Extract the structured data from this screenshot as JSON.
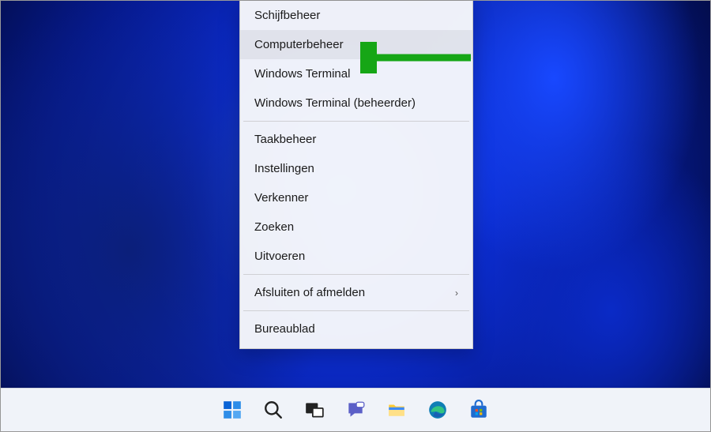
{
  "menu": {
    "items": [
      {
        "label": "Schijfbeheer",
        "hovered": false,
        "hasSubmenu": false
      },
      {
        "label": "Computerbeheer",
        "hovered": true,
        "hasSubmenu": false
      },
      {
        "label": "Windows Terminal",
        "hovered": false,
        "hasSubmenu": false
      },
      {
        "label": "Windows Terminal (beheerder)",
        "hovered": false,
        "hasSubmenu": false,
        "dividerAfter": true
      },
      {
        "label": "Taakbeheer",
        "hovered": false,
        "hasSubmenu": false
      },
      {
        "label": "Instellingen",
        "hovered": false,
        "hasSubmenu": false
      },
      {
        "label": "Verkenner",
        "hovered": false,
        "hasSubmenu": false
      },
      {
        "label": "Zoeken",
        "hovered": false,
        "hasSubmenu": false
      },
      {
        "label": "Uitvoeren",
        "hovered": false,
        "hasSubmenu": false,
        "dividerAfter": true
      },
      {
        "label": "Afsluiten of afmelden",
        "hovered": false,
        "hasSubmenu": true,
        "dividerAfter": true
      },
      {
        "label": "Bureaublad",
        "hovered": false,
        "hasSubmenu": false
      }
    ]
  },
  "annotation": {
    "arrowColor": "#16a616"
  },
  "taskbar": {
    "items": [
      {
        "name": "start-icon"
      },
      {
        "name": "search-icon"
      },
      {
        "name": "taskview-icon"
      },
      {
        "name": "chat-icon"
      },
      {
        "name": "explorer-icon"
      },
      {
        "name": "edge-icon"
      },
      {
        "name": "store-icon"
      }
    ]
  }
}
